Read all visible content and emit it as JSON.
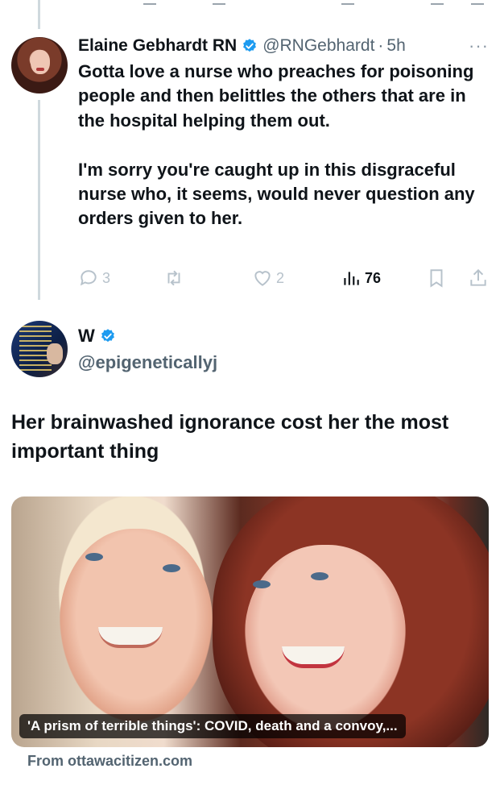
{
  "reply_tweet": {
    "display_name": "Elaine Gebhardt RN",
    "handle": "@RNGebhardt",
    "separator": "·",
    "time": "5h",
    "more": "···",
    "text": "Gotta love a nurse who preaches for poisoning people and then belittles the others that are in the hospital helping them out.\n\nI'm sorry you're caught up in this disgraceful nurse who, it seems, would never question any orders given to her.",
    "actions": {
      "reply_count": "3",
      "retweet_count": "",
      "like_count": "2",
      "view_count": "76"
    }
  },
  "main_tweet": {
    "display_name": "W",
    "handle": "@epigeneticallyj",
    "text": "Her brainwashed ignorance cost her the most important thing",
    "card": {
      "caption": "'A prism of terrible things': COVID, death and a convoy,...",
      "source": "From ottawacitizen.com"
    }
  },
  "colors": {
    "verified": "#1d9bf0",
    "muted": "#536471",
    "action_icon": "#b7c2cb",
    "thread_line": "#cfd9de"
  },
  "icons": [
    "verified-badge-icon",
    "more-icon",
    "reply-icon",
    "retweet-icon",
    "like-icon",
    "views-icon",
    "bookmark-icon",
    "share-icon"
  ]
}
